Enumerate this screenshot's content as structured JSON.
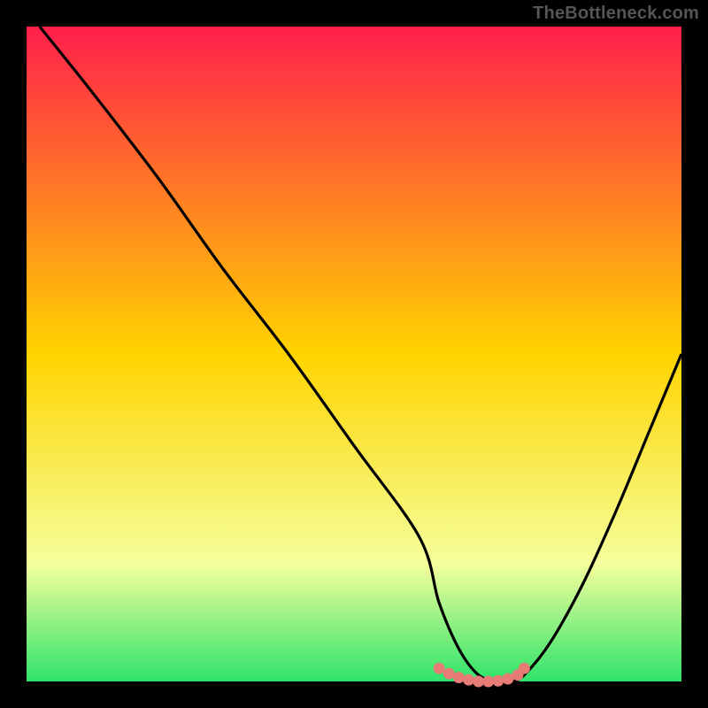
{
  "watermark": "TheBottleneck.com",
  "colors": {
    "bg": "#000000",
    "curve": "#000000",
    "marker_fill": "#e77b76",
    "marker_stroke": "#e77b76",
    "gradient_top": "#ff1f4b",
    "gradient_mid": "#ffd400",
    "gradient_low": "#f5ff9c",
    "gradient_bottom": "#2fe36b"
  },
  "chart_data": {
    "type": "line",
    "title": "",
    "xlabel": "",
    "ylabel": "",
    "xlim": [
      0,
      100
    ],
    "ylim": [
      0,
      100
    ],
    "grid": false,
    "legend": false,
    "x": [
      2,
      10,
      20,
      30,
      40,
      50,
      60,
      63,
      66,
      69,
      72,
      74,
      76,
      80,
      85,
      90,
      95,
      100
    ],
    "y": [
      100,
      90,
      77,
      63,
      50,
      36,
      22,
      12,
      5,
      1,
      0,
      0,
      1,
      6,
      15,
      26,
      38,
      50
    ],
    "markers": {
      "x": [
        63,
        64.5,
        66,
        67.5,
        69,
        70.5,
        72,
        73.5,
        75,
        76
      ],
      "y": [
        2.0,
        1.2,
        0.6,
        0.25,
        0.0,
        0.0,
        0.1,
        0.4,
        1.0,
        2.0
      ]
    }
  }
}
